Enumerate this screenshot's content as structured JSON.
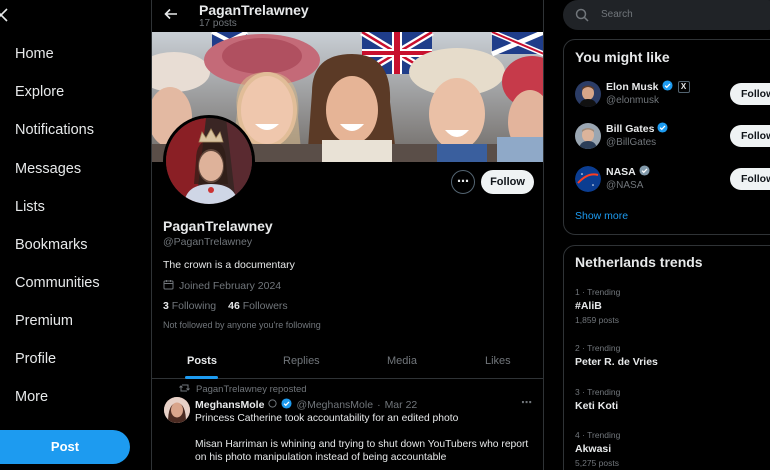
{
  "nav": {
    "items": [
      "Home",
      "Explore",
      "Notifications",
      "Messages",
      "Lists",
      "Bookmarks",
      "Communities",
      "Premium",
      "Profile",
      "More"
    ],
    "post_label": "Post"
  },
  "header": {
    "name": "PaganTrelawney",
    "post_count": "17 posts"
  },
  "profile": {
    "follow_label": "Follow",
    "display_name": "PaganTrelawney",
    "handle": "@PaganTrelawney",
    "bio": "The crown is a documentary",
    "joined": "Joined February 2024",
    "following_count": "3",
    "following_label": "Following",
    "followers_count": "46",
    "followers_label": "Followers",
    "follow_note": "Not followed by anyone you're following"
  },
  "tabs": [
    "Posts",
    "Replies",
    "Media",
    "Likes"
  ],
  "tweet": {
    "reposted_by": "PaganTrelawney reposted",
    "author": "MeghansMole",
    "handle": "@MeghansMole",
    "date": "Mar 22",
    "text_1": "Princess Catherine took accountability for an edited photo",
    "text_2": "Misan Harriman is whining and trying to shut down YouTubers who report on his photo manipulation instead of being accountable"
  },
  "search": {
    "placeholder": "Search"
  },
  "you_might_like": {
    "title": "You might like",
    "users": [
      {
        "name": "Elon Musk",
        "handle": "@elonmusk",
        "follow": "Follow"
      },
      {
        "name": "Bill Gates",
        "handle": "@BillGates",
        "follow": "Follow"
      },
      {
        "name": "NASA",
        "handle": "@NASA",
        "follow": "Follow"
      }
    ],
    "show_more": "Show more"
  },
  "trends": {
    "title": "Netherlands trends",
    "items": [
      {
        "category": "1 · Trending",
        "name": "#AliB",
        "posts": "1,859 posts"
      },
      {
        "category": "2 · Trending",
        "name": "Peter R. de Vries",
        "posts": ""
      },
      {
        "category": "3 · Trending",
        "name": "Keti Koti",
        "posts": ""
      },
      {
        "category": "4 · Trending",
        "name": "Akwasi",
        "posts": "5,275 posts"
      }
    ]
  },
  "colors": {
    "accent": "#1d9bf0",
    "background": "#000000",
    "border": "#2f3336",
    "muted": "#71767b"
  }
}
